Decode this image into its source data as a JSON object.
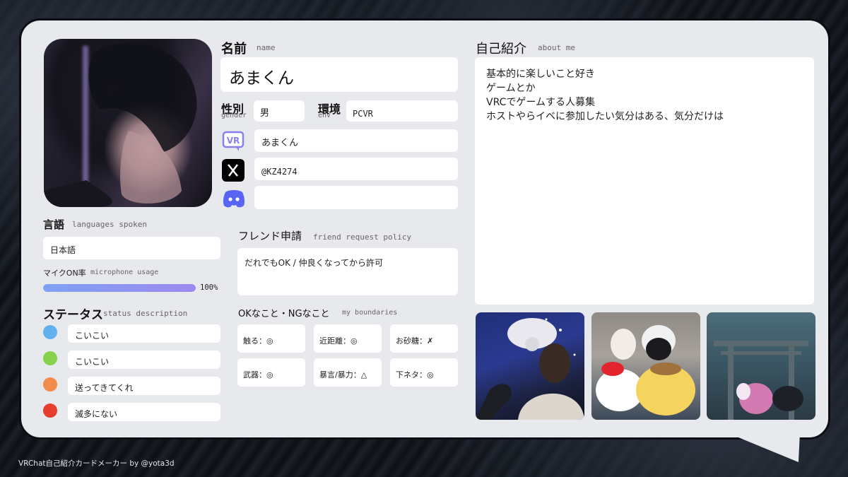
{
  "name": {
    "label": "名前",
    "label_en": "name",
    "value": "あまくん"
  },
  "gender": {
    "label": "性別",
    "label_en": "gender",
    "value": "男"
  },
  "env": {
    "label": "環境",
    "label_en": "env",
    "value": "PCVR"
  },
  "vrchat": {
    "icon": "vrchat-icon",
    "value": "あまくん"
  },
  "x": {
    "icon": "x-logo-icon",
    "value": "@KZ4274"
  },
  "discord": {
    "icon": "discord-icon",
    "value": ""
  },
  "languages": {
    "label": "言語",
    "label_en": "languages spoken",
    "value": "日本語"
  },
  "mic": {
    "label": "マイクON率",
    "label_en": "microphone usage",
    "percent_text": "100%",
    "fraction": 1.0
  },
  "status": {
    "label": "ステータス",
    "label_en": "status description",
    "items": [
      {
        "color": "#63b0ee",
        "text": "こいこい"
      },
      {
        "color": "#86d24c",
        "text": "こいこい"
      },
      {
        "color": "#f38b4a",
        "text": "送ってきてくれ"
      },
      {
        "color": "#e83c2c",
        "text": "滅多にない"
      }
    ]
  },
  "friend_policy": {
    "label": "フレンド申請",
    "label_en": "friend request policy",
    "value": "だれでもOK / 仲良くなってから許可"
  },
  "boundaries": {
    "label": "OKなこと・NGなこと",
    "label_en": "my boundaries",
    "items": [
      {
        "label": "触る：",
        "mark": "◎"
      },
      {
        "label": "近距離：",
        "mark": "◎"
      },
      {
        "label": "お砂糖：",
        "mark": "✗"
      },
      {
        "label": "武器：",
        "mark": "◎"
      },
      {
        "label": "暴言/暴力：",
        "mark": "△"
      },
      {
        "label": "下ネタ：",
        "mark": "◎"
      }
    ]
  },
  "about": {
    "label": "自己紹介",
    "label_en": "about me",
    "lines": [
      "基本的に楽しいこと好き",
      "ゲームとか",
      "VRCでゲームする人募集",
      "ホストやらイベに参加したい気分はある、気分だけは"
    ]
  },
  "footer": "VRChat自己紹介カードメーカー by @yota3d",
  "colors": {
    "accent_bar": "#7f99f2",
    "discord": "#5865f2",
    "vrchat": "#8a7ff0"
  }
}
